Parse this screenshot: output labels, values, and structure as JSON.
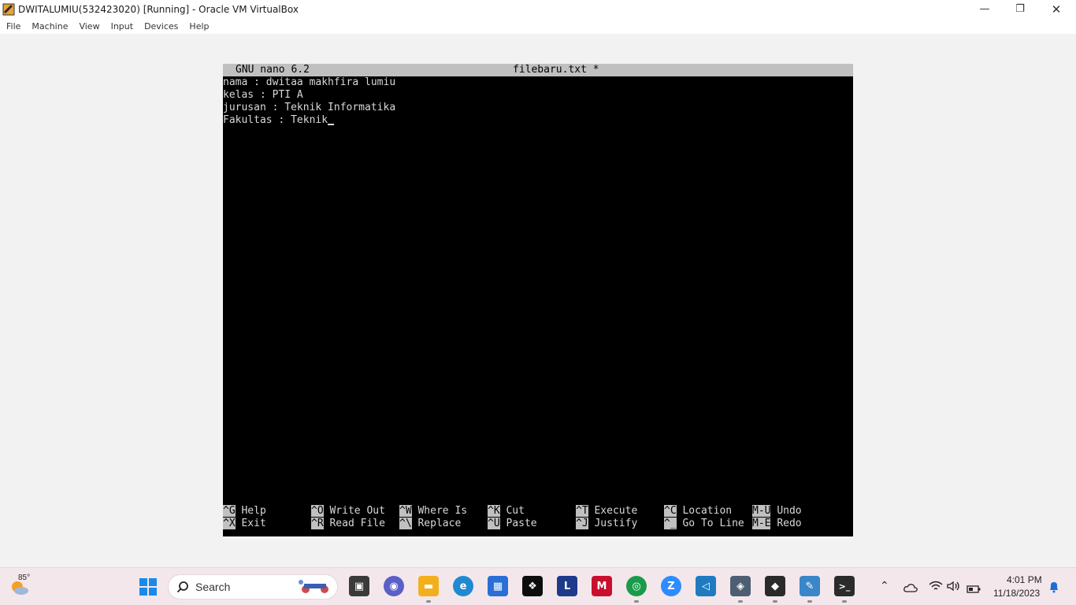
{
  "window": {
    "title": "DWITALUMIU(532423020) [Running] - Oracle VM VirtualBox",
    "minimize": "—",
    "restore": "❐",
    "close": "✕"
  },
  "menu": [
    "File",
    "Machine",
    "View",
    "Input",
    "Devices",
    "Help"
  ],
  "nano": {
    "version": "GNU nano 6.2",
    "filename": "filebaru.txt *",
    "lines": [
      "nama : dwitaa makhfira lumiu",
      "kelas : PTI A",
      "jurusan : Teknik Informatika",
      "Fakultas : Teknik"
    ],
    "shortcuts_row1": [
      {
        "key": "^G",
        "label": "Help"
      },
      {
        "key": "^O",
        "label": "Write Out"
      },
      {
        "key": "^W",
        "label": "Where Is"
      },
      {
        "key": "^K",
        "label": "Cut"
      },
      {
        "key": "^T",
        "label": "Execute"
      },
      {
        "key": "^C",
        "label": "Location"
      },
      {
        "key": "M-U",
        "label": "Undo"
      }
    ],
    "shortcuts_row2": [
      {
        "key": "^X",
        "label": "Exit"
      },
      {
        "key": "^R",
        "label": "Read File"
      },
      {
        "key": "^\\",
        "label": "Replace"
      },
      {
        "key": "^U",
        "label": "Paste"
      },
      {
        "key": "^J",
        "label": "Justify"
      },
      {
        "key": "^_",
        "label": "Go To Line"
      },
      {
        "key": "M-E",
        "label": "Redo"
      }
    ]
  },
  "taskbar": {
    "weather": "85°",
    "search_label": "Search",
    "apps": [
      {
        "name": "task-view",
        "glyph": "▣",
        "color": "#3a3a3a"
      },
      {
        "name": "teams-chat",
        "glyph": "◉",
        "color": "#5b5fc7"
      },
      {
        "name": "file-explorer",
        "glyph": "▬",
        "color": "#f2b01e"
      },
      {
        "name": "edge",
        "glyph": "e",
        "color": "#1f8ad2"
      },
      {
        "name": "microsoft-store",
        "glyph": "▦",
        "color": "#2a6fd6"
      },
      {
        "name": "dropbox",
        "glyph": "❖",
        "color": "#0d0d0d"
      },
      {
        "name": "l-app",
        "glyph": "L",
        "color": "#1e3a8a"
      },
      {
        "name": "mcafee",
        "glyph": "M",
        "color": "#c8102e"
      },
      {
        "name": "chrome",
        "glyph": "◎",
        "color": "#1a9b4b"
      },
      {
        "name": "zoom",
        "glyph": "Z",
        "color": "#2d8cff"
      },
      {
        "name": "vscode",
        "glyph": "◁",
        "color": "#1f7bc1"
      },
      {
        "name": "virtualbox",
        "glyph": "◈",
        "color": "#4d5e73"
      },
      {
        "name": "virtualbox-vm",
        "glyph": "◆",
        "color": "#2a2a2a"
      },
      {
        "name": "paint",
        "glyph": "✎",
        "color": "#3a86c8"
      },
      {
        "name": "terminal",
        "glyph": ">_",
        "color": "#2b2b2b"
      }
    ],
    "time": "4:01 PM",
    "date": "11/18/2023"
  }
}
